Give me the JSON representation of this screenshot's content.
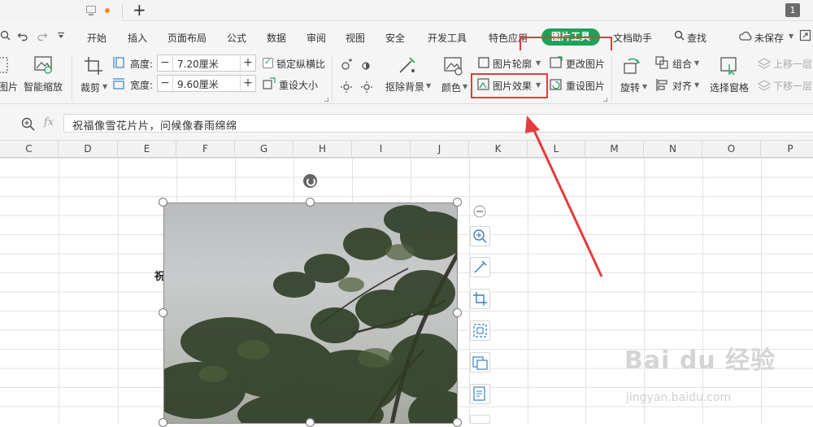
{
  "titlebar": {
    "page_number": "1",
    "new_tab_symbol": "+"
  },
  "menu": {
    "items": [
      "开始",
      "插入",
      "页面布局",
      "公式",
      "数据",
      "审阅",
      "视图",
      "安全",
      "开发工具",
      "特色应用",
      "图片工具",
      "文档助手",
      "查找",
      "未保存"
    ],
    "active": "图片工具"
  },
  "ribbon": {
    "left_partial_label": "图片",
    "smart_zoom": "智能缩放",
    "crop": "裁剪",
    "height_label": "高度:",
    "height_value": "7.20厘米",
    "width_label": "宽度:",
    "width_value": "9.60厘米",
    "lock_ratio": "锁定纵横比",
    "reset_size": "重设大小",
    "remove_bg": "抠除背景",
    "color": "颜色",
    "picture_outline": "图片轮廓",
    "picture_effect": "图片效果",
    "change_picture": "更改图片",
    "reset_picture": "重设图片",
    "rotate": "旋转",
    "group": "组合",
    "align": "对齐",
    "selection_pane": "选择窗格",
    "bring_forward": "上移一层",
    "send_backward": "下移一层"
  },
  "formula": {
    "fx": "fx",
    "content": "祝福像雪花片片，问候像春雨绵绵"
  },
  "columns": [
    "C",
    "D",
    "E",
    "F",
    "G",
    "H",
    "I",
    "J",
    "K",
    "L",
    "M",
    "N",
    "O",
    "P"
  ],
  "cell_partial_text": "祝",
  "watermark": {
    "main": "Bai du 经验",
    "sub": "jingyan.baidu.com"
  },
  "icons": {
    "plus": "plus-icon",
    "monitor": "monitor-icon",
    "undo": "undo-icon",
    "redo": "redo-icon",
    "search": "search-icon",
    "cloud": "cloud-icon",
    "zoom-in": "zoom-in-icon"
  },
  "colors": {
    "accent_green": "#1ea25a",
    "annotation_red": "#e53b3b",
    "badge_orange": "#f08a24"
  }
}
